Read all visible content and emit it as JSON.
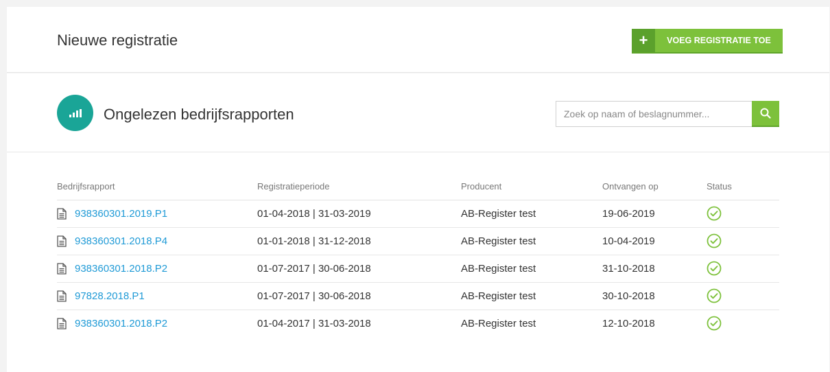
{
  "header": {
    "title": "Nieuwe registratie",
    "add_button_icon": "plus-icon",
    "add_button_label": "VOEG REGISTRATIE TOE"
  },
  "reports_section": {
    "icon": "signal-bars-icon",
    "title": "Ongelezen bedrijfsrapporten",
    "search": {
      "value": "",
      "placeholder": "Zoek op naam of beslagnummer...",
      "button_icon": "search-icon"
    }
  },
  "table": {
    "columns": [
      "Bedrijfsrapport",
      "Registratieperiode",
      "Producent",
      "Ontvangen op",
      "Status"
    ],
    "rows": [
      {
        "report": "938360301.2019.P1",
        "period": "01-04-2018 | 31-03-2019",
        "producer": "AB-Register test",
        "received": "19-06-2019",
        "status": "check-circle-icon"
      },
      {
        "report": "938360301.2018.P4",
        "period": "01-01-2018 | 31-12-2018",
        "producer": "AB-Register test",
        "received": "10-04-2019",
        "status": "check-circle-icon"
      },
      {
        "report": "938360301.2018.P2",
        "period": "01-07-2017 | 30-06-2018",
        "producer": "AB-Register test",
        "received": "31-10-2018",
        "status": "check-circle-icon"
      },
      {
        "report": "97828.2018.P1",
        "period": "01-07-2017 | 30-06-2018",
        "producer": "AB-Register test",
        "received": "30-10-2018",
        "status": "check-circle-icon"
      },
      {
        "report": "938360301.2018.P2",
        "period": "01-04-2017 | 31-03-2018",
        "producer": "AB-Register test",
        "received": "12-10-2018",
        "status": "check-circle-icon"
      }
    ]
  },
  "colors": {
    "accent_green": "#7dc13b",
    "teal": "#1aa597",
    "link_blue": "#1f9ad6"
  }
}
